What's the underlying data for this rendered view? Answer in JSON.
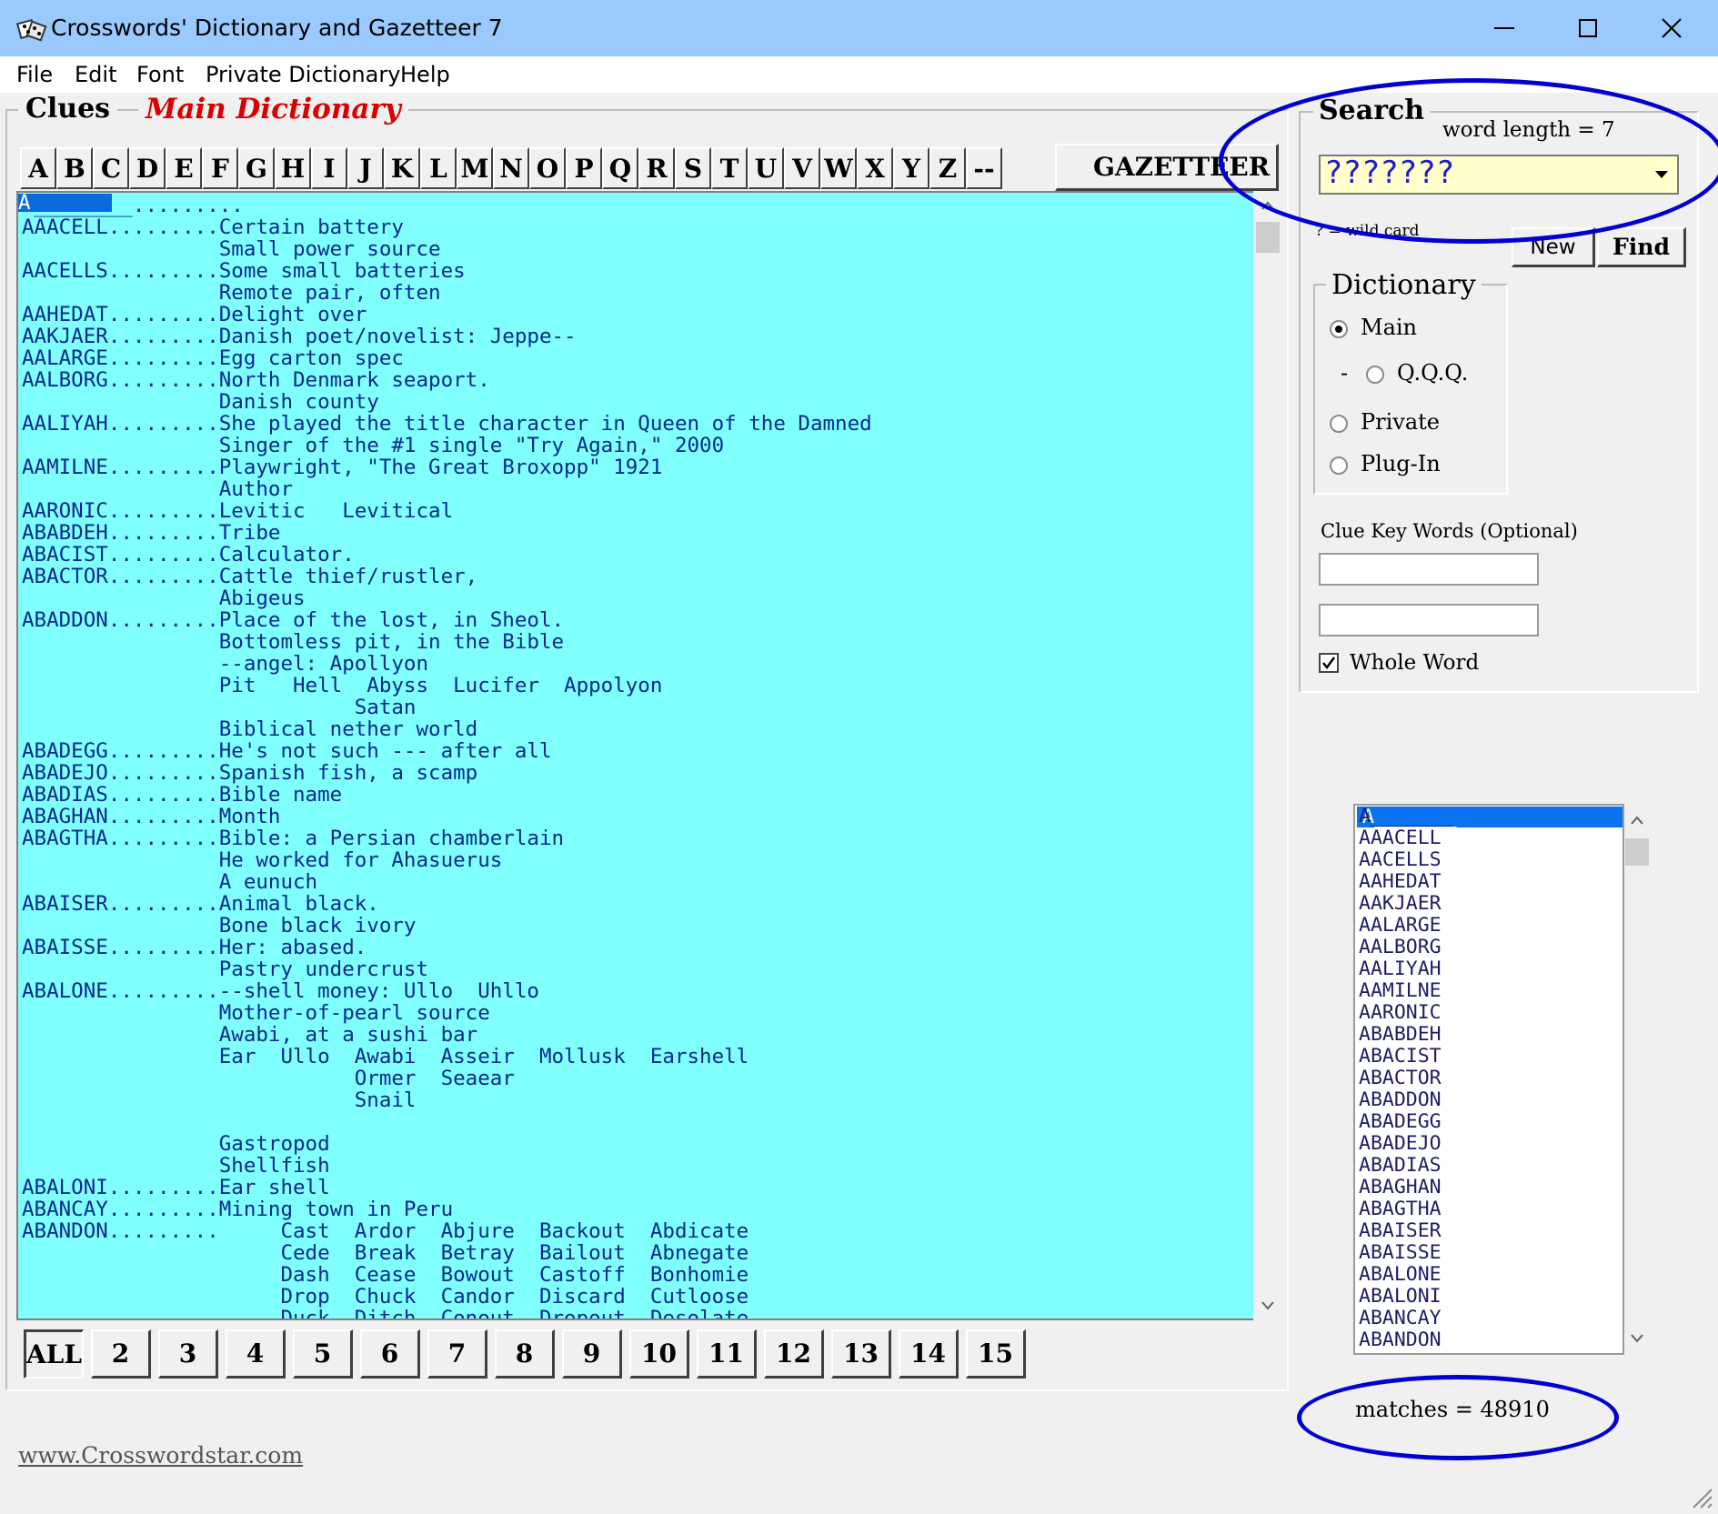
{
  "window": {
    "title": "Crosswords' Dictionary and Gazetteer 7",
    "controls": {
      "minimize": "—",
      "maximize": "☐",
      "close": "✕"
    }
  },
  "menu": [
    "File",
    "Edit",
    "Font",
    "Private Dictionary",
    "Help"
  ],
  "clues_panel": {
    "group_label": "Clues",
    "dictionary_label": "Main Dictionary",
    "letters": [
      "A",
      "B",
      "C",
      "D",
      "E",
      "F",
      "G",
      "H",
      "I",
      "J",
      "K",
      "L",
      "M",
      "N",
      "O",
      "P",
      "Q",
      "R",
      "S",
      "T",
      "U",
      "V",
      "W",
      "X",
      "Y",
      "Z",
      "--"
    ],
    "gazetteer_button": "GAZETTEER",
    "selected_entry": "A_______",
    "entries_text": "A________.........\nAAACELL.........Certain battery\n                Small power source\nAACELLS.........Some small batteries\n                Remote pair, often\nAAHEDAT.........Delight over\nAAKJAER.........Danish poet/novelist: Jeppe--\nAALARGE.........Egg carton spec\nAALBORG.........North Denmark seaport.\n                Danish county\nAALIYAH.........She played the title character in Queen of the Damned\n                Singer of the #1 single \"Try Again,\" 2000\nAAMILNE.........Playwright, \"The Great Broxopp\" 1921\n                Author\nAARONIC.........Levitic   Levitical\nABABDEH.........Tribe\nABACIST.........Calculator.\nABACTOR.........Cattle thief/rustler,\n                Abigeus\nABADDON.........Place of the lost, in Sheol.\n                Bottomless pit, in the Bible\n                --angel: Apollyon\n                Pit   Hell  Abyss  Lucifer  Appolyon\n                           Satan\n                Biblical nether world\nABADEGG.........He's not such --- after all\nABADEJO.........Spanish fish, a scamp\nABADIAS.........Bible name\nABAGHAN.........Month\nABAGTHA.........Bible: a Persian chamberlain\n                He worked for Ahasuerus\n                A eunuch\nABAISER.........Animal black.\n                Bone black ivory\nABAISSE.........Her: abased.\n                Pastry undercrust\nABALONE.........--shell money: Ullo  Uhllo\n                Mother-of-pearl source\n                Awabi, at a sushi bar\n                Ear  Ullo  Awabi  Asseir  Mollusk  Earshell\n                           Ormer  Seaear\n                           Snail\n\n                Gastropod\n                Shellfish\nABALONI.........Ear shell\nABANCAY.........Mining town in Peru\nABANDON.........     Cast  Ardor  Abjure  Backout  Abdicate\n                     Cede  Break  Betray  Bailout  Abnegate\n                     Dash  Cease  Bowout  Castoff  Bonhomie\n                     Drop  Chuck  Candor  Discard  Cutloose\n                     Duck  Ditch  Conout  Dropout  Desolate",
    "length_buttons": [
      "ALL",
      "2",
      "3",
      "4",
      "5",
      "6",
      "7",
      "8",
      "9",
      "10",
      "11",
      "12",
      "13",
      "14",
      "15"
    ],
    "active_length": "ALL"
  },
  "link": "www.Crosswordstar.com",
  "search_panel": {
    "group_label": "Search",
    "word_length_label": "word length =  7",
    "search_value": "???????",
    "wildcard_hint": "? = wild card",
    "new_button": "New",
    "find_button": "Find",
    "dictionary_group": "Dictionary",
    "dictionary_options": {
      "main": "Main",
      "qqq_prefix": "-",
      "qqq": "Q.Q.Q.",
      "private": "Private",
      "plugin": "Plug-In"
    },
    "selected_dictionary": "Main",
    "clue_key_words_label": "Clue Key Words (Optional)",
    "clue_key_word_1": "",
    "clue_key_word_2": "",
    "whole_word_label": "Whole Word",
    "whole_word_checked": true
  },
  "word_list": {
    "items": "A_______\nAAACELL\nAACELLS\nAAHEDAT\nAAKJAER\nAALARGE\nAALBORG\nAALIYAH\nAAMILNE\nAARONIC\nABABDEH\nABACIST\nABACTOR\nABADDON\nABADEGG\nABADEJO\nABADIAS\nABAGHAN\nABAGTHA\nABAISER\nABAISSE\nABALONE\nABALONI\nABANCAY\nABANDON",
    "selected": "A_______"
  },
  "matches_label": "matches =  48910",
  "colors": {
    "title_bar": "#99c9fd",
    "clue_background": "#80ffff",
    "clue_text": "#0a2a8a",
    "dictionary_label": "#d80000",
    "search_field": "#ffffcc",
    "selection": "#0a6adf",
    "annotation": "#0000d2"
  },
  "icons": [
    "app-dice-icon",
    "combo-arrow-icon",
    "scroll-up-icon",
    "scroll-down-icon",
    "resize-grip-icon"
  ]
}
